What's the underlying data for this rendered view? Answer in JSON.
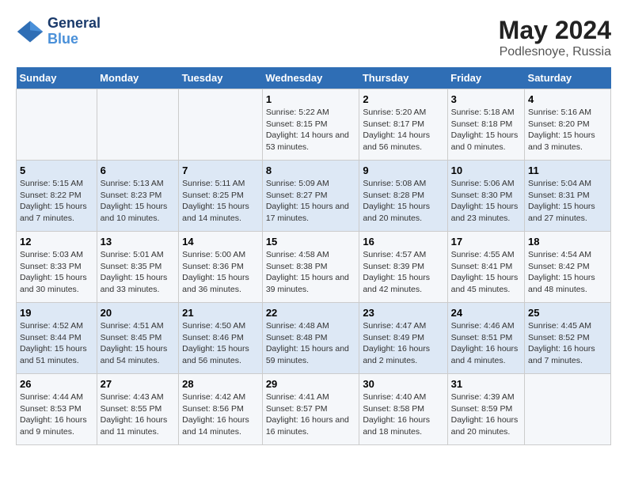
{
  "logo": {
    "line1": "General",
    "line2": "Blue"
  },
  "title": "May 2024",
  "subtitle": "Podlesnoye, Russia",
  "headers": [
    "Sunday",
    "Monday",
    "Tuesday",
    "Wednesday",
    "Thursday",
    "Friday",
    "Saturday"
  ],
  "weeks": [
    [
      {
        "day": "",
        "text": ""
      },
      {
        "day": "",
        "text": ""
      },
      {
        "day": "",
        "text": ""
      },
      {
        "day": "1",
        "text": "Sunrise: 5:22 AM\nSunset: 8:15 PM\nDaylight: 14 hours and 53 minutes."
      },
      {
        "day": "2",
        "text": "Sunrise: 5:20 AM\nSunset: 8:17 PM\nDaylight: 14 hours and 56 minutes."
      },
      {
        "day": "3",
        "text": "Sunrise: 5:18 AM\nSunset: 8:18 PM\nDaylight: 15 hours and 0 minutes."
      },
      {
        "day": "4",
        "text": "Sunrise: 5:16 AM\nSunset: 8:20 PM\nDaylight: 15 hours and 3 minutes."
      }
    ],
    [
      {
        "day": "5",
        "text": "Sunrise: 5:15 AM\nSunset: 8:22 PM\nDaylight: 15 hours and 7 minutes."
      },
      {
        "day": "6",
        "text": "Sunrise: 5:13 AM\nSunset: 8:23 PM\nDaylight: 15 hours and 10 minutes."
      },
      {
        "day": "7",
        "text": "Sunrise: 5:11 AM\nSunset: 8:25 PM\nDaylight: 15 hours and 14 minutes."
      },
      {
        "day": "8",
        "text": "Sunrise: 5:09 AM\nSunset: 8:27 PM\nDaylight: 15 hours and 17 minutes."
      },
      {
        "day": "9",
        "text": "Sunrise: 5:08 AM\nSunset: 8:28 PM\nDaylight: 15 hours and 20 minutes."
      },
      {
        "day": "10",
        "text": "Sunrise: 5:06 AM\nSunset: 8:30 PM\nDaylight: 15 hours and 23 minutes."
      },
      {
        "day": "11",
        "text": "Sunrise: 5:04 AM\nSunset: 8:31 PM\nDaylight: 15 hours and 27 minutes."
      }
    ],
    [
      {
        "day": "12",
        "text": "Sunrise: 5:03 AM\nSunset: 8:33 PM\nDaylight: 15 hours and 30 minutes."
      },
      {
        "day": "13",
        "text": "Sunrise: 5:01 AM\nSunset: 8:35 PM\nDaylight: 15 hours and 33 minutes."
      },
      {
        "day": "14",
        "text": "Sunrise: 5:00 AM\nSunset: 8:36 PM\nDaylight: 15 hours and 36 minutes."
      },
      {
        "day": "15",
        "text": "Sunrise: 4:58 AM\nSunset: 8:38 PM\nDaylight: 15 hours and 39 minutes."
      },
      {
        "day": "16",
        "text": "Sunrise: 4:57 AM\nSunset: 8:39 PM\nDaylight: 15 hours and 42 minutes."
      },
      {
        "day": "17",
        "text": "Sunrise: 4:55 AM\nSunset: 8:41 PM\nDaylight: 15 hours and 45 minutes."
      },
      {
        "day": "18",
        "text": "Sunrise: 4:54 AM\nSunset: 8:42 PM\nDaylight: 15 hours and 48 minutes."
      }
    ],
    [
      {
        "day": "19",
        "text": "Sunrise: 4:52 AM\nSunset: 8:44 PM\nDaylight: 15 hours and 51 minutes."
      },
      {
        "day": "20",
        "text": "Sunrise: 4:51 AM\nSunset: 8:45 PM\nDaylight: 15 hours and 54 minutes."
      },
      {
        "day": "21",
        "text": "Sunrise: 4:50 AM\nSunset: 8:46 PM\nDaylight: 15 hours and 56 minutes."
      },
      {
        "day": "22",
        "text": "Sunrise: 4:48 AM\nSunset: 8:48 PM\nDaylight: 15 hours and 59 minutes."
      },
      {
        "day": "23",
        "text": "Sunrise: 4:47 AM\nSunset: 8:49 PM\nDaylight: 16 hours and 2 minutes."
      },
      {
        "day": "24",
        "text": "Sunrise: 4:46 AM\nSunset: 8:51 PM\nDaylight: 16 hours and 4 minutes."
      },
      {
        "day": "25",
        "text": "Sunrise: 4:45 AM\nSunset: 8:52 PM\nDaylight: 16 hours and 7 minutes."
      }
    ],
    [
      {
        "day": "26",
        "text": "Sunrise: 4:44 AM\nSunset: 8:53 PM\nDaylight: 16 hours and 9 minutes."
      },
      {
        "day": "27",
        "text": "Sunrise: 4:43 AM\nSunset: 8:55 PM\nDaylight: 16 hours and 11 minutes."
      },
      {
        "day": "28",
        "text": "Sunrise: 4:42 AM\nSunset: 8:56 PM\nDaylight: 16 hours and 14 minutes."
      },
      {
        "day": "29",
        "text": "Sunrise: 4:41 AM\nSunset: 8:57 PM\nDaylight: 16 hours and 16 minutes."
      },
      {
        "day": "30",
        "text": "Sunrise: 4:40 AM\nSunset: 8:58 PM\nDaylight: 16 hours and 18 minutes."
      },
      {
        "day": "31",
        "text": "Sunrise: 4:39 AM\nSunset: 8:59 PM\nDaylight: 16 hours and 20 minutes."
      },
      {
        "day": "",
        "text": ""
      }
    ]
  ]
}
